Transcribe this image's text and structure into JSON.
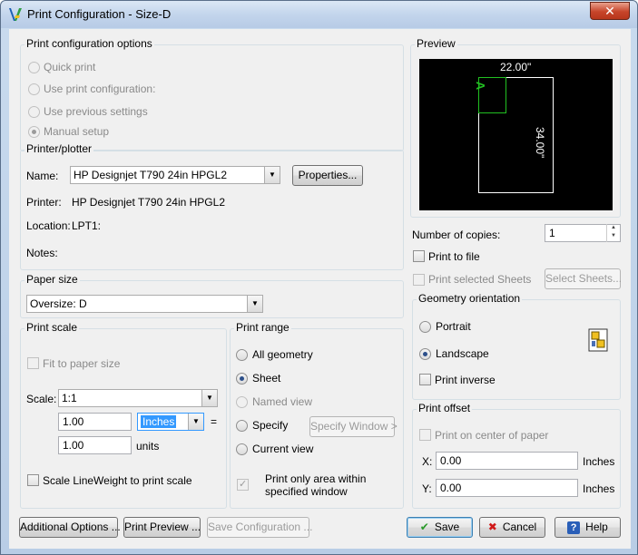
{
  "window": {
    "title": "Print Configuration - Size-D",
    "close_glyph": "✕"
  },
  "options": {
    "label": "Print configuration options",
    "items": [
      "Quick print",
      "Use print configuration:",
      "Use previous settings",
      "Manual setup"
    ],
    "selected": "Manual setup"
  },
  "printer": {
    "label": "Printer/plotter",
    "name_label": "Name:",
    "name_value": "HP Designjet T790 24in HPGL2",
    "properties_button": "Properties...",
    "printer_label": "Printer:",
    "printer_value": "HP Designjet T790 24in HPGL2",
    "location_label": "Location:",
    "location_value": "LPT1:",
    "notes_label": "Notes:"
  },
  "paper": {
    "label": "Paper size",
    "value": "Oversize: D"
  },
  "scale": {
    "label": "Print scale",
    "fit": "Fit to paper size",
    "scale_label": "Scale:",
    "scale_value": "1:1",
    "value1": "1.00",
    "unit_select": "Inches",
    "equals": "=",
    "value2": "1.00",
    "units_label": "units",
    "lineweight": "Scale LineWeight to print scale"
  },
  "range": {
    "label": "Print range",
    "items": [
      "All geometry",
      "Sheet",
      "Named view",
      "Specify",
      "Current view"
    ],
    "selected": "Sheet",
    "specify_window": "Specify Window >",
    "only_area": "Print only area within specified window"
  },
  "preview": {
    "label": "Preview",
    "width": "22.00\"",
    "height": "34.00\"",
    "sheet_letter": "A"
  },
  "copies": {
    "label": "Number of copies:",
    "value": "1"
  },
  "print_to_file": "Print to file",
  "selected_sheets": {
    "label": "Print selected Sheets",
    "button": "Select Sheets..."
  },
  "orientation": {
    "label": "Geometry orientation",
    "portrait": "Portrait",
    "landscape": "Landscape",
    "selected": "Landscape",
    "inverse": "Print inverse"
  },
  "offset": {
    "label": "Print offset",
    "center": "Print on center of paper",
    "x_label": "X:",
    "x_value": "0.00",
    "x_unit": "Inches",
    "y_label": "Y:",
    "y_value": "0.00",
    "y_unit": "Inches"
  },
  "footer": {
    "additional": "Additional Options ...",
    "print_preview": "Print Preview ...",
    "save_config": "Save Configuration ...",
    "save": "Save",
    "cancel": "Cancel",
    "help": "Help"
  },
  "colors": {
    "preview_bg": "#000000",
    "sheet_marker": "#22c022"
  }
}
